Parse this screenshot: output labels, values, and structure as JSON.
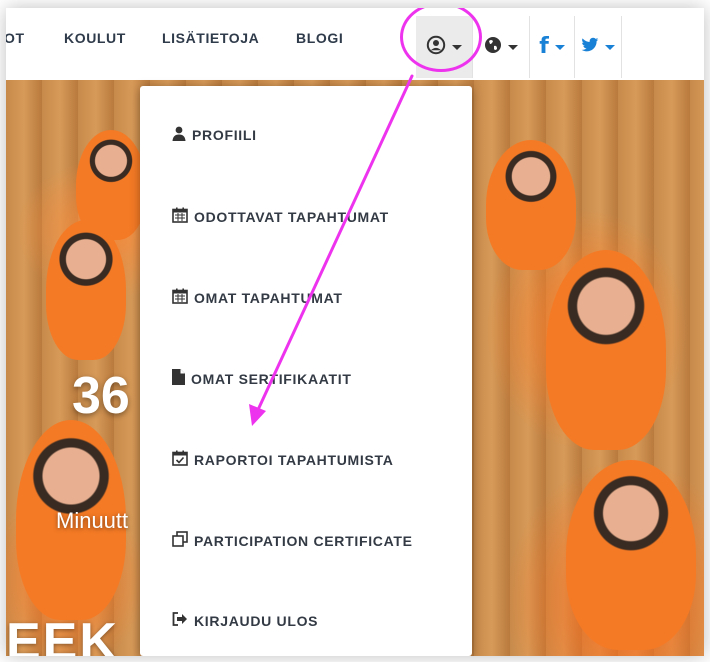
{
  "navbar": {
    "partial_item": "OT",
    "links": [
      "KOULUT",
      "LISÄTIETOJA",
      "BLOGI"
    ]
  },
  "icons": {
    "user": "user-circle-icon",
    "language": "globe-icon",
    "facebook": "facebook-icon",
    "twitter": "twitter-icon"
  },
  "user_menu": {
    "items": [
      {
        "label": "PROFIILI",
        "icon": "user-icon"
      },
      {
        "label": "ODOTTAVAT TAPAHTUMAT",
        "icon": "calendar-icon"
      },
      {
        "label": "OMAT TAPAHTUMAT",
        "icon": "calendar-icon"
      },
      {
        "label": "OMAT SERTIFIKAATIT",
        "icon": "file-icon"
      },
      {
        "label": "RAPORTOI TAPAHTUMISTA",
        "icon": "calendar-check-icon"
      },
      {
        "label": "PARTICIPATION CERTIFICATE",
        "icon": "copy-icon"
      },
      {
        "label": "KIRJAUDU ULOS",
        "icon": "sign-out-icon"
      }
    ]
  },
  "hero": {
    "stat": "36",
    "caption": "Minuutt",
    "big_text": "EEK"
  },
  "colors": {
    "accent_blue": "#1a82d6",
    "annotation_pink": "#ee33ee",
    "hero_orange": "#f47a25"
  }
}
